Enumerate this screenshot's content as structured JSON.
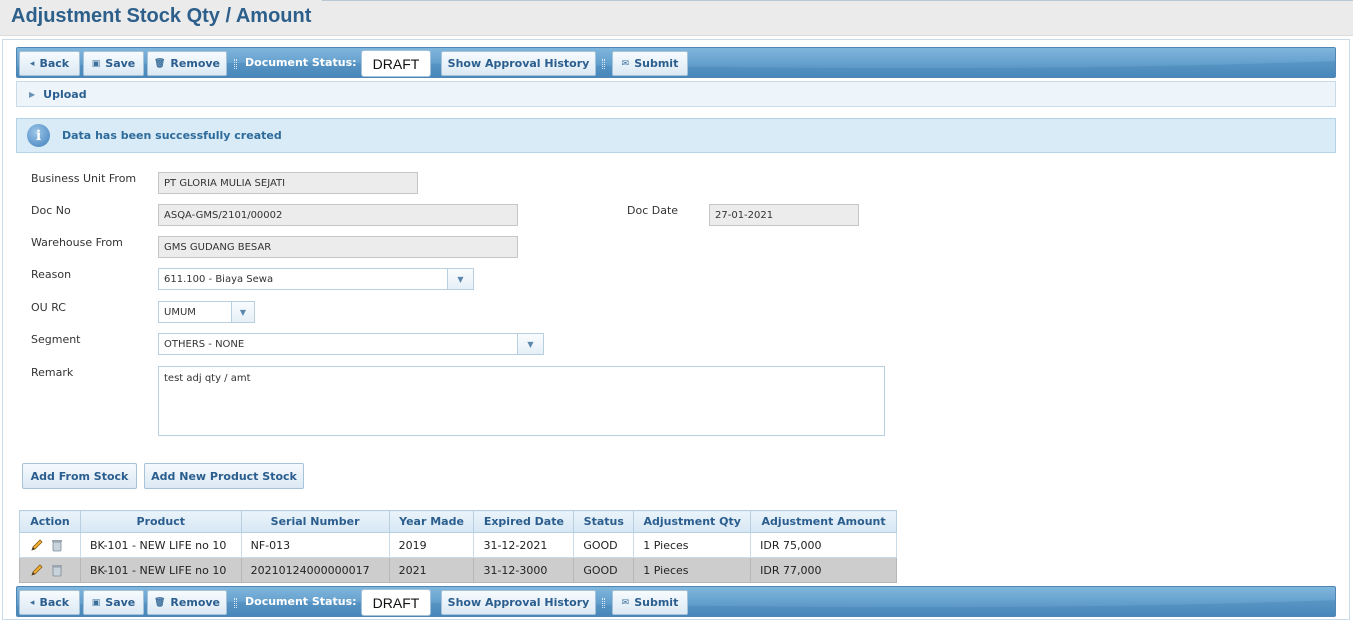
{
  "page": {
    "title": "Adjustment Stock Qty / Amount"
  },
  "toolbar": {
    "back_label": "Back",
    "save_label": "Save",
    "remove_label": "Remove",
    "status_label": "Document Status:",
    "status_value": "DRAFT",
    "approval_label": "Show Approval History",
    "submit_label": "Submit"
  },
  "upload": {
    "label": "Upload"
  },
  "message": {
    "text": "Data has been successfully created"
  },
  "form": {
    "business_unit_from": {
      "label": "Business Unit From",
      "value": "PT GLORIA MULIA SEJATI"
    },
    "doc_no": {
      "label": "Doc No",
      "value": "ASQA-GMS/2101/00002"
    },
    "doc_date": {
      "label": "Doc Date",
      "value": "27-01-2021"
    },
    "warehouse_from": {
      "label": "Warehouse From",
      "value": "GMS GUDANG BESAR"
    },
    "reason": {
      "label": "Reason",
      "value": "611.100 - Biaya Sewa"
    },
    "ou_rc": {
      "label": "OU RC",
      "value": "UMUM"
    },
    "segment": {
      "label": "Segment",
      "value": "OTHERS - NONE"
    },
    "remark": {
      "label": "Remark",
      "value": "test adj qty / amt"
    }
  },
  "actions": {
    "add_from_stock": "Add From Stock",
    "add_new_product_stock": "Add New Product Stock"
  },
  "grid": {
    "columns": [
      "Action",
      "Product",
      "Serial Number",
      "Year Made",
      "Expired Date",
      "Status",
      "Adjustment Qty",
      "Adjustment Amount"
    ],
    "rows": [
      {
        "product": "BK-101 - NEW LIFE no 10",
        "serial": "NF-013",
        "year": "2019",
        "expired": "31-12-2021",
        "status": "GOOD",
        "qty": "1 Pieces",
        "amount": "IDR 75,000"
      },
      {
        "product": "BK-101 - NEW LIFE no 10",
        "serial": "20210124000000017",
        "year": "2021",
        "expired": "31-12-3000",
        "status": "GOOD",
        "qty": "1 Pieces",
        "amount": "IDR 77,000"
      }
    ]
  },
  "colors": {
    "brand": "#2d5f8b",
    "toolbar": "#5f9ccc",
    "info": "#d8ebf6"
  },
  "icons": [
    "back-icon",
    "save-icon",
    "remove-icon",
    "submit-icon",
    "info-icon",
    "edit-icon",
    "trash-icon",
    "dropdown-icon",
    "expand-icon"
  ]
}
